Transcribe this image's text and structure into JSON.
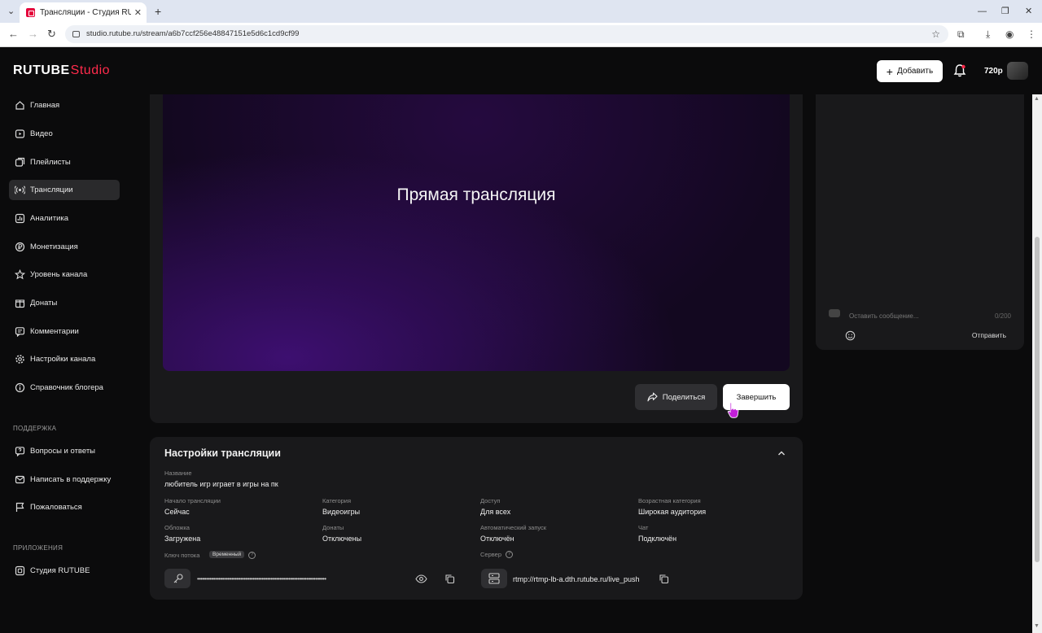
{
  "browser": {
    "tab_title": "Трансляции - Студия RUTUBE",
    "tab_close": "✕",
    "new_tab": "+",
    "url": "studio.rutube.ru/stream/a6b7ccf256e48847151e5d6c1cd9cf99",
    "window_controls": [
      "—",
      "❐",
      "✕"
    ]
  },
  "header": {
    "logo_main": "RUTUBE",
    "logo_studio": "Studio",
    "add_label": "Добавить",
    "quality": "720p"
  },
  "sidebar": {
    "items": [
      {
        "label": "Главная",
        "icon": "home-icon"
      },
      {
        "label": "Видео",
        "icon": "video-icon"
      },
      {
        "label": "Плейлисты",
        "icon": "playlist-icon"
      },
      {
        "label": "Трансляции",
        "icon": "broadcast-icon",
        "active": true
      },
      {
        "label": "Аналитика",
        "icon": "analytics-icon"
      },
      {
        "label": "Монетизация",
        "icon": "monetization-icon"
      },
      {
        "label": "Уровень канала",
        "icon": "star-icon"
      },
      {
        "label": "Донаты",
        "icon": "donate-icon"
      },
      {
        "label": "Комментарии",
        "icon": "comments-icon"
      },
      {
        "label": "Настройки канала",
        "icon": "gear-icon"
      },
      {
        "label": "Справочник блогера",
        "icon": "info-icon"
      }
    ],
    "support_heading": "ПОДДЕРЖКА",
    "support_items": [
      {
        "label": "Вопросы и ответы",
        "icon": "faq-icon"
      },
      {
        "label": "Написать в поддержку",
        "icon": "mail-icon"
      },
      {
        "label": "Пожаловаться",
        "icon": "flag-icon"
      }
    ],
    "apps_heading": "ПРИЛОЖЕНИЯ",
    "apps_items": [
      {
        "label": "Студия RUTUBE",
        "icon": "app-icon"
      }
    ]
  },
  "player": {
    "title": "Прямая трансляция",
    "share_label": "Поделиться",
    "finish_label": "Завершить"
  },
  "chat": {
    "placeholder": "Оставить сообщение...",
    "counter": "0/200",
    "send_label": "Отправить"
  },
  "settings": {
    "title": "Настройки трансляции",
    "name_label": "Название",
    "name_value": "любитель игр играет в игры на пк",
    "fields": [
      {
        "label": "Начало трансляции",
        "value": "Сейчас"
      },
      {
        "label": "Категория",
        "value": "Видеоигры"
      },
      {
        "label": "Доступ",
        "value": "Для всех"
      },
      {
        "label": "Возрастная категория",
        "value": "Широкая аудитория"
      },
      {
        "label": "Обложка",
        "value": "Загружена"
      },
      {
        "label": "Донаты",
        "value": "Отключены"
      },
      {
        "label": "Автоматический запуск",
        "value": "Отключён"
      },
      {
        "label": "Чат",
        "value": "Подключён"
      }
    ],
    "key_label": "Ключ потока",
    "key_badge": "Временный",
    "key_value": "••••••••••••••••••••••••••••••••••••••••••••••••••••••••••••••••••••••••",
    "server_label": "Сервер",
    "server_value": "rtmp://rtmp-lb-a.dth.rutube.ru/live_push",
    "help": "?"
  },
  "colors": {
    "accent": "#ff2b4c",
    "background": "#0b0b0c",
    "card": "#19191b",
    "active_item": "#2a2a2c"
  }
}
